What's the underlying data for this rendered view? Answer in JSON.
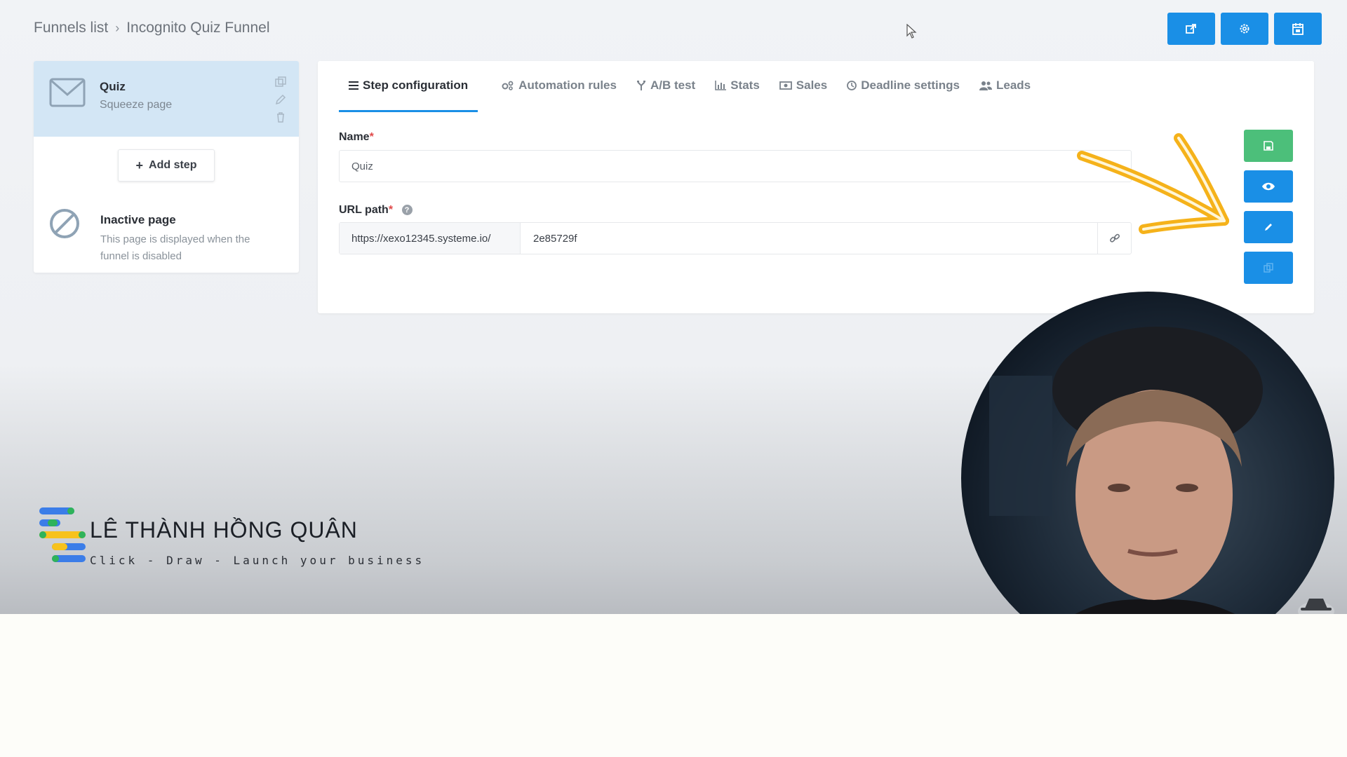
{
  "breadcrumb": {
    "root": "Funnels list",
    "separator": "›",
    "current": "Incognito Quiz Funnel"
  },
  "top_actions": [
    {
      "icon": "external-link-icon"
    },
    {
      "icon": "gear-icon"
    },
    {
      "icon": "calendar-icon"
    }
  ],
  "left_panel": {
    "active_step": {
      "title": "Quiz",
      "subtitle": "Squeeze page",
      "icon": "mail-icon"
    },
    "add_step_label": "Add step",
    "inactive": {
      "title": "Inactive page",
      "description": "This page is displayed when the funnel is disabled",
      "icon": "ban-icon"
    }
  },
  "tabs": [
    {
      "label": "Step configuration",
      "icon": "list-icon",
      "active": true
    },
    {
      "label": "Automation rules",
      "icon": "cogs-icon",
      "active": false
    },
    {
      "label": "A/B test",
      "icon": "split-icon",
      "active": false
    },
    {
      "label": "Stats",
      "icon": "bar-chart-icon",
      "active": false
    },
    {
      "label": "Sales",
      "icon": "money-icon",
      "active": false
    },
    {
      "label": "Deadline settings",
      "icon": "clock-icon",
      "active": false
    },
    {
      "label": "Leads",
      "icon": "users-icon",
      "active": false
    }
  ],
  "form": {
    "name_label": "Name",
    "required_mark": "*",
    "name_value": "Quiz",
    "url_label": "URL path",
    "url_prefix": "https://xexo12345.systeme.io/",
    "url_value": "2e85729f"
  },
  "side_actions": [
    {
      "icon": "save-icon",
      "color": "#4cbf7a"
    },
    {
      "icon": "eye-icon",
      "color": "#1a8fe6"
    },
    {
      "icon": "pencil-icon",
      "color": "#1a8fe6"
    },
    {
      "icon": "copy-icon",
      "color": "#1a8fe6"
    }
  ],
  "branding": {
    "name": "LÊ THÀNH HỒNG QUÂN",
    "tagline": "Click - Draw - Launch your business"
  },
  "colors": {
    "primary": "#1a8fe6",
    "success": "#4cbf7a",
    "active_step_bg": "#d3e6f5",
    "annotation_arrow": "#f5b21a"
  }
}
